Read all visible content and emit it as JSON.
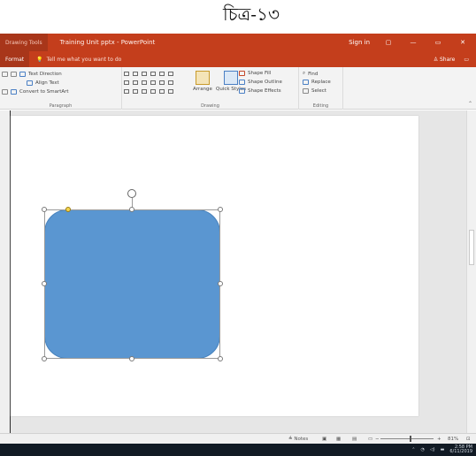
{
  "caption": "চিত্র-১৩",
  "window": {
    "context_tab": "Drawing Tools",
    "title": "Training Unit pptx - PowerPoint",
    "signin": "Sign in",
    "controls": [
      "▢",
      "—",
      "▭",
      "✕"
    ]
  },
  "tabs": {
    "active": "Format",
    "tellme": "Tell me what you want to do",
    "share": "Share"
  },
  "ribbon": {
    "groups": [
      {
        "label": "Paragraph"
      },
      {
        "label": "Drawing"
      },
      {
        "label": "Editing"
      }
    ],
    "paragraph_items": [
      "Text Direction",
      "Align Text",
      "Convert to SmartArt"
    ],
    "drawing_buttons": {
      "arrange": "Arrange",
      "quick_styles": "Quick Styles"
    },
    "shape_format": [
      "Shape Fill",
      "Shape Outline",
      "Shape Effects"
    ],
    "editing": [
      "Find",
      "Replace",
      "Select"
    ]
  },
  "statusbar": {
    "notes": "Notes",
    "zoom": "81%"
  },
  "taskbar": {
    "time": "2:58 PM",
    "date": "6/11/2019"
  },
  "colors": {
    "accent": "#c43e1c",
    "shape_fill": "#5a96d1"
  }
}
